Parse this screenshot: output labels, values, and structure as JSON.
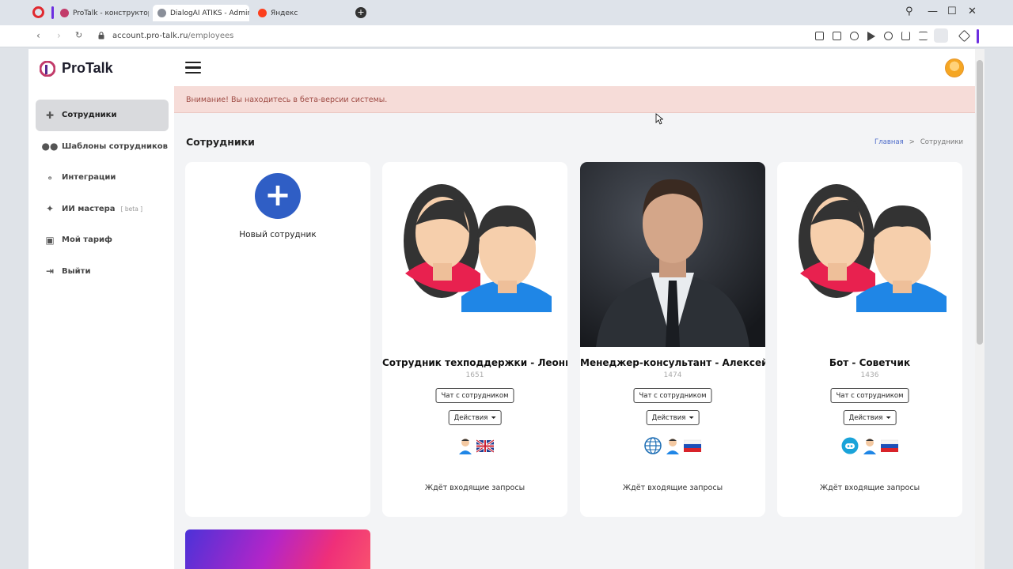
{
  "browser": {
    "tabs": [
      {
        "title": "ProTalk - конструктор GP",
        "active": false
      },
      {
        "title": "DialogAI ATIKS - Admin P",
        "active": true
      },
      {
        "title": "Яндекс",
        "active": false
      }
    ],
    "url_host": "account.pro-talk.ru",
    "url_path": "/employees"
  },
  "app": {
    "logo_text": "ProTalk",
    "menu": [
      {
        "label": "Сотрудники",
        "icon": "add-person-icon",
        "active": true
      },
      {
        "label": "Шаблоны сотрудников",
        "icon": "people-icon",
        "active": false
      },
      {
        "label": "Интеграции",
        "icon": "integrations-icon",
        "active": false
      },
      {
        "label": "ИИ мастера",
        "badge": "[ beta ]",
        "icon": "magic-wand-icon",
        "active": false
      },
      {
        "label": "Мой тариф",
        "icon": "tariff-icon",
        "active": false
      },
      {
        "label": "Выйти",
        "icon": "logout-icon",
        "active": false
      }
    ],
    "alert": "Внимание! Вы находитесь в бета-версии системы."
  },
  "page": {
    "title": "Сотрудники",
    "breadcrumb": {
      "home": "Главная",
      "separator": ">",
      "current": "Сотрудники"
    },
    "new_employee_label": "Новый сотрудник",
    "cards": [
      {
        "name": "Сотрудник техподдержки - Леонид",
        "id": "1651",
        "chat_label": "Чат с сотрудником",
        "actions_label": "Действия",
        "status": "Ждёт входящие запросы",
        "image": "avatar-pair-illustration",
        "badges": [
          "person-icon",
          "uk-flag-icon"
        ]
      },
      {
        "name": "Менеджер-консультант - Алексей",
        "id": "1474",
        "chat_label": "Чат с сотрудником",
        "actions_label": "Действия",
        "status": "Ждёт входящие запросы",
        "image": "businessman-photo",
        "badges": [
          "globe-icon",
          "person-icon",
          "russia-flag-icon"
        ]
      },
      {
        "name": "Бот - Советчик",
        "id": "1436",
        "chat_label": "Чат с сотрудником",
        "actions_label": "Действия",
        "status": "Ждёт входящие запросы",
        "image": "avatar-pair-illustration",
        "badges": [
          "bot-icon",
          "person-icon",
          "russia-flag-icon"
        ]
      }
    ]
  },
  "colors": {
    "accent": "#2f5ec5",
    "alert_bg": "#f6dcd8",
    "alert_text": "#9e4a43",
    "link": "#4c6ac9"
  }
}
